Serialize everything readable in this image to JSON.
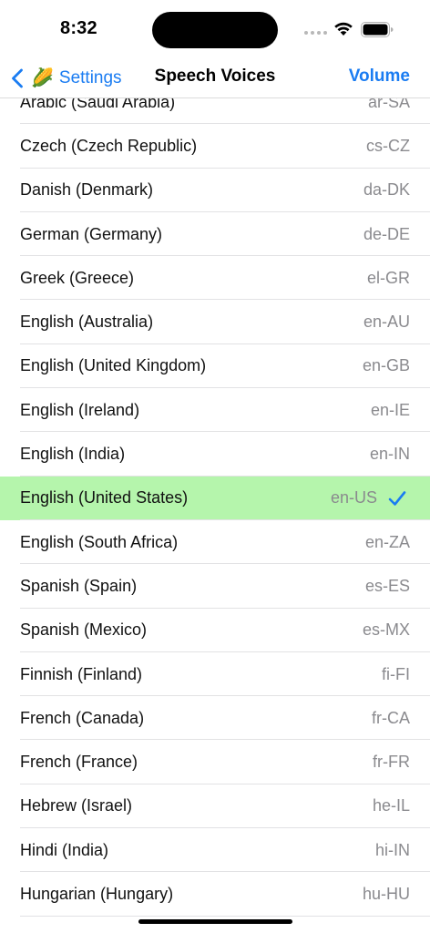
{
  "status_bar": {
    "time": "8:32"
  },
  "nav": {
    "back_label": "Settings",
    "back_emoji": "🌽",
    "title": "Speech Voices",
    "right_button": "Volume"
  },
  "colors": {
    "accent": "#1a7cf2",
    "selected_row": "#b5f5ac"
  },
  "voices": [
    {
      "name": "Arabic (Saudi Arabia)",
      "code": "ar-SA"
    },
    {
      "name": "Czech (Czech Republic)",
      "code": "cs-CZ"
    },
    {
      "name": "Danish (Denmark)",
      "code": "da-DK"
    },
    {
      "name": "German (Germany)",
      "code": "de-DE"
    },
    {
      "name": "Greek (Greece)",
      "code": "el-GR"
    },
    {
      "name": "English (Australia)",
      "code": "en-AU"
    },
    {
      "name": "English (United Kingdom)",
      "code": "en-GB"
    },
    {
      "name": "English (Ireland)",
      "code": "en-IE"
    },
    {
      "name": "English (India)",
      "code": "en-IN"
    },
    {
      "name": "English (United States)",
      "code": "en-US",
      "selected": true
    },
    {
      "name": "English (South Africa)",
      "code": "en-ZA"
    },
    {
      "name": "Spanish (Spain)",
      "code": "es-ES"
    },
    {
      "name": "Spanish (Mexico)",
      "code": "es-MX"
    },
    {
      "name": "Finnish (Finland)",
      "code": "fi-FI"
    },
    {
      "name": "French (Canada)",
      "code": "fr-CA"
    },
    {
      "name": "French (France)",
      "code": "fr-FR"
    },
    {
      "name": "Hebrew (Israel)",
      "code": "he-IL"
    },
    {
      "name": "Hindi (India)",
      "code": "hi-IN"
    },
    {
      "name": "Hungarian (Hungary)",
      "code": "hu-HU"
    }
  ]
}
